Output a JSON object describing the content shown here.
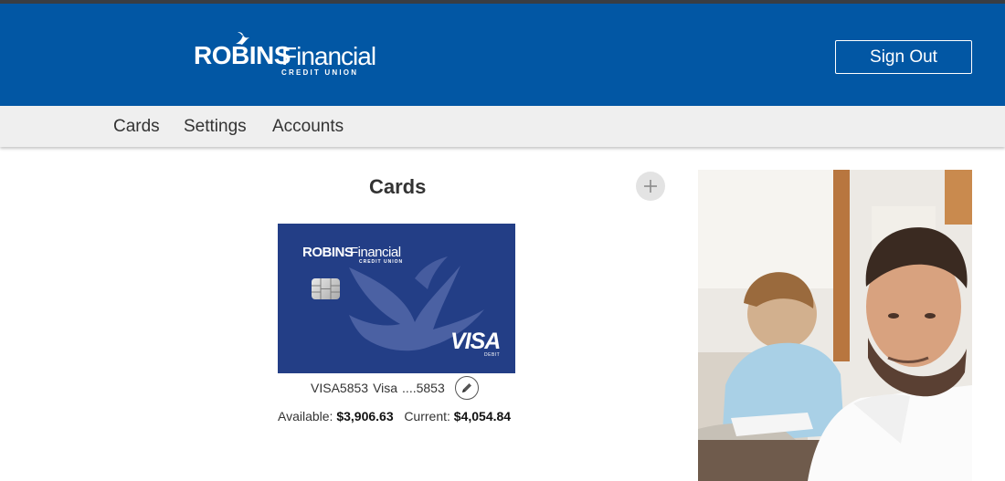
{
  "header": {
    "logo": {
      "brand_bold": "ROBINS",
      "brand_light": "Financial",
      "brand_sub": "CREDIT UNION"
    },
    "sign_out_label": "Sign Out"
  },
  "nav": {
    "items": [
      {
        "label": "Cards"
      },
      {
        "label": "Settings"
      },
      {
        "label": "Accounts"
      }
    ]
  },
  "main": {
    "title": "Cards",
    "add_icon": "plus-icon",
    "card": {
      "image": {
        "brand_bold": "ROBINS",
        "brand_light": "Financial",
        "brand_sub": "CREDIT UNION",
        "network": "VISA",
        "network_sub": "DEBIT",
        "color": "#233e86"
      },
      "nickname": "VISA5853",
      "type": "Visa",
      "masked_number": "....5853",
      "edit_icon": "pencil-icon",
      "available_label": "Available:",
      "available_value": "$3,906.63",
      "current_label": "Current:",
      "current_value": "$4,054.84"
    }
  },
  "sidebar": {
    "photo": "man-reading-photo"
  },
  "colors": {
    "header_bg": "#0257a4",
    "nav_bg": "#efefef",
    "card_bg": "#233e86"
  }
}
